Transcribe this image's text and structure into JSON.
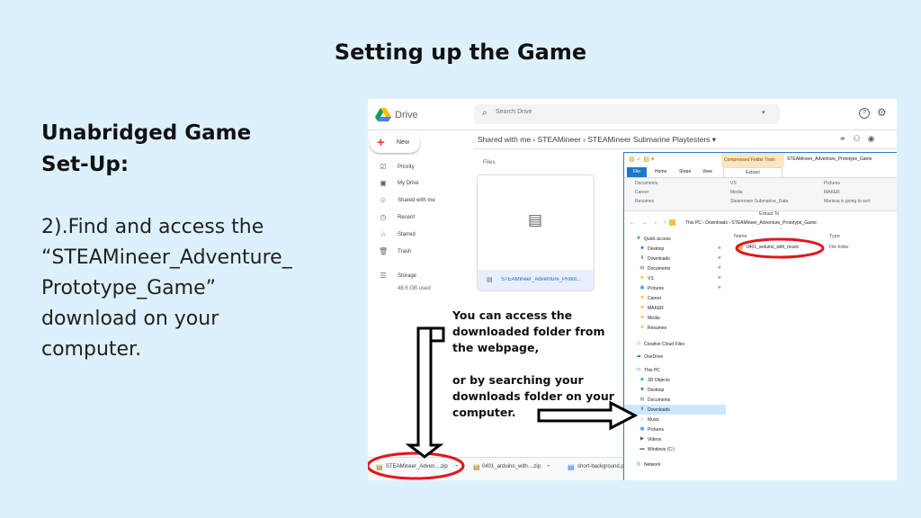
{
  "slide": {
    "title": "Setting up the Game",
    "heading_line1": "Unabridged Game",
    "heading_line2": "Set-Up:",
    "body_lines": [
      "2).Find and access the",
      "“STEAMineer_Adventure_",
      "Prototype_Game”",
      "download on your",
      "computer."
    ]
  },
  "drive": {
    "app_name": "Drive",
    "search_placeholder": "Search Drive",
    "new_label": "New",
    "nav": [
      "Priority",
      "My Drive",
      "Shared with me",
      "Recent",
      "Starred",
      "Trash"
    ],
    "storage_label": "Storage",
    "storage_used": "48.6 GB used",
    "breadcrumb": "Shared with me  ›  STEAMineer  ›  STEAMineer Submarine Playtesters  ▾",
    "files_label": "Files",
    "file_name": "STEAMineer_Adventure_Protot..."
  },
  "downloads": [
    {
      "name": "STEAMineer_Adven....zip"
    },
    {
      "name": "0401_arduino_with....zip"
    },
    {
      "name": "short-background.p"
    }
  ],
  "explorer": {
    "contextual_tab_label": "Compressed Folder Tools",
    "window_title": "STEAMineer_Adventure_Prototype_Game",
    "tabs": [
      "File",
      "Home",
      "Share",
      "View"
    ],
    "extract_tab": "Extract",
    "ribbon_col1": [
      "Documents",
      "Career",
      "Resumes"
    ],
    "ribbon_col2": [
      "VS",
      "Media",
      "Steammein Submarine_Data"
    ],
    "ribbon_col3": [
      "Pictures",
      "MAKER",
      "Marissa is going to sort"
    ],
    "ribbon_caption": "Extract To",
    "nav_arrows": "← → ↓ ↑",
    "path": "This PC  ›  Downloads  ›  STEAMineer_Adventure_Prototype_Game",
    "column_name": "Name",
    "column_type": "Type",
    "row_name": "0401_arduino_with_music",
    "row_type": "File folder",
    "nav_pane": [
      {
        "label": "Quick access",
        "pinned": false,
        "child": false
      },
      {
        "label": "Desktop",
        "pinned": true,
        "child": true
      },
      {
        "label": "Downloads",
        "pinned": true,
        "child": true
      },
      {
        "label": "Documents",
        "pinned": true,
        "child": true
      },
      {
        "label": "VS",
        "pinned": true,
        "child": true
      },
      {
        "label": "Pictures",
        "pinned": true,
        "child": true
      },
      {
        "label": "Career",
        "pinned": false,
        "child": true
      },
      {
        "label": "MAKER",
        "pinned": false,
        "child": true
      },
      {
        "label": "Media",
        "pinned": false,
        "child": true
      },
      {
        "label": "Resumes",
        "pinned": false,
        "child": true
      },
      {
        "label": "Creative Cloud Files",
        "pinned": false,
        "child": false
      },
      {
        "label": "OneDrive",
        "pinned": false,
        "child": false
      },
      {
        "label": "This PC",
        "pinned": false,
        "child": false
      },
      {
        "label": "3D Objects",
        "pinned": false,
        "child": true
      },
      {
        "label": "Desktop",
        "pinned": false,
        "child": true
      },
      {
        "label": "Documents",
        "pinned": false,
        "child": true
      },
      {
        "label": "Downloads",
        "pinned": false,
        "child": true
      },
      {
        "label": "Music",
        "pinned": false,
        "child": true
      },
      {
        "label": "Pictures",
        "pinned": false,
        "child": true
      },
      {
        "label": "Videos",
        "pinned": false,
        "child": true
      },
      {
        "label": "Windows (C:)",
        "pinned": false,
        "child": true
      },
      {
        "label": "Network",
        "pinned": false,
        "child": false
      }
    ]
  },
  "annotation": {
    "line1": "You can access the",
    "line2": "downloaded folder from",
    "line3": "the webpage,",
    "line4": "or by searching your",
    "line5": "downloads folder on your",
    "line6": "computer."
  },
  "colors": {
    "background": "#ddf1fc",
    "highlight_ring": "#e3161d",
    "drive_blue": "#1967d2",
    "explorer_accent": "#1979ca"
  }
}
